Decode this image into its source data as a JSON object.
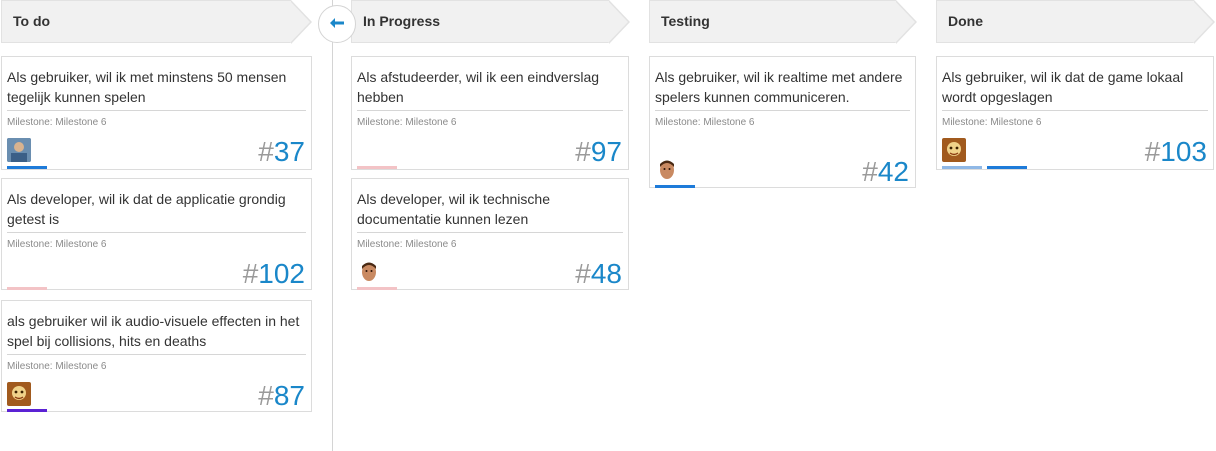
{
  "columns": [
    {
      "title": "To do"
    },
    {
      "title": "In Progress"
    },
    {
      "title": "Testing"
    },
    {
      "title": "Done"
    }
  ],
  "cards": [
    {
      "col": 0,
      "title": "Als gebruiker, wil ik met minstens 50 mensen tegelijk kunnen spelen",
      "milestone": "Milestone: Milestone 6",
      "number": "37",
      "avatar": "avatar-blue-shirt"
    },
    {
      "col": 0,
      "title": "Als developer, wil ik dat de applicatie grondig getest is",
      "milestone": "Milestone: Milestone 6",
      "number": "102",
      "avatar": ""
    },
    {
      "col": 0,
      "title": "als gebruiker wil ik audio-visuele effecten in het spel bij collisions, hits en deaths",
      "milestone": "Milestone: Milestone 6",
      "number": "87",
      "avatar": "avatar-cartoon"
    },
    {
      "col": 1,
      "title": "Als afstudeerder, wil ik een eindverslag hebben",
      "milestone": "Milestone: Milestone 6",
      "number": "97",
      "avatar": ""
    },
    {
      "col": 1,
      "title": "Als developer, wil ik technische documentatie kunnen lezen",
      "milestone": "Milestone: Milestone 6",
      "number": "48",
      "avatar": "avatar-face"
    },
    {
      "col": 2,
      "title": "Als gebruiker, wil ik realtime met andere spelers kunnen communiceren.",
      "milestone": "Milestone: Milestone 6",
      "number": "42",
      "avatar": "avatar-face"
    },
    {
      "col": 3,
      "title": "Als gebruiker, wil ik dat de game lokaal wordt opgeslagen",
      "milestone": "Milestone: Milestone 6",
      "number": "103",
      "avatar": "avatar-cartoon"
    }
  ],
  "hash_symbol": "#",
  "colors": {
    "accent": "#1a87c9",
    "bar_blue": "#1e7bd9",
    "bar_pink": "#f3c3c6",
    "bar_purple": "#5b22d4",
    "bar_lightblue": "#8fb8e6"
  },
  "icons": {
    "back": "arrow-left-icon"
  }
}
